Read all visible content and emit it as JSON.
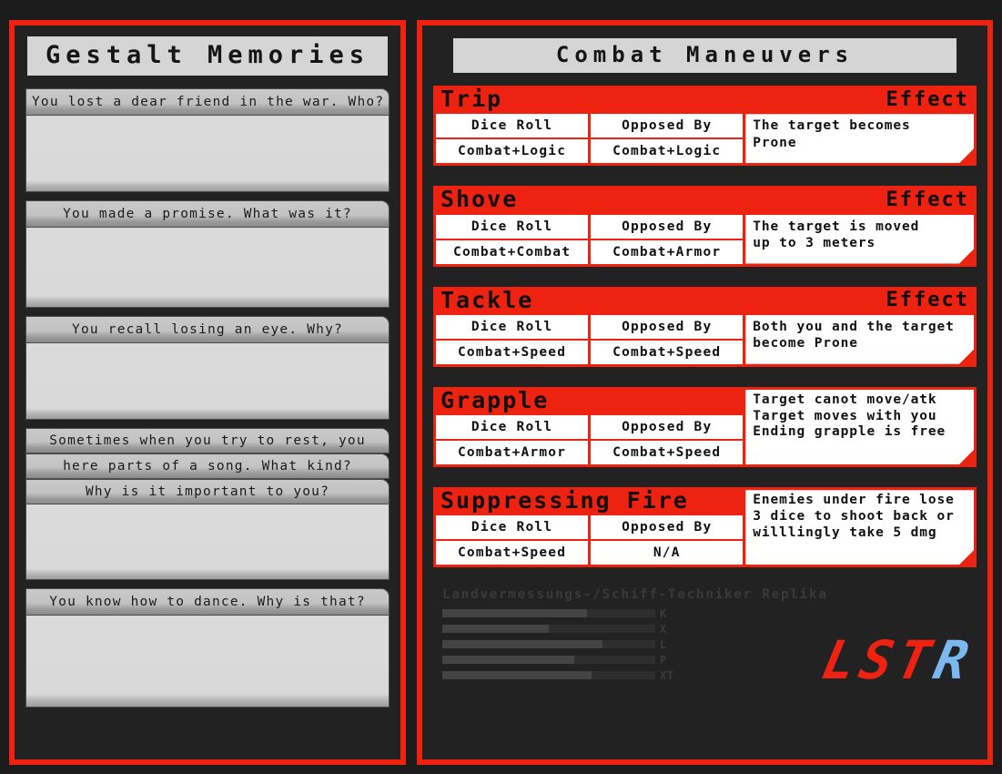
{
  "theme": {
    "accent_red": "#ee2211",
    "panel_bg": "#222222",
    "page_bg": "#1c1c1c",
    "plate": "#d5d5d5",
    "logo_blue": "#7cb8f0"
  },
  "left_panel": {
    "title": "Gestalt Memories",
    "memories": [
      {
        "question": "You lost a dear friend in the war. Who?",
        "answer": ""
      },
      {
        "question": "You made a promise. What was it?",
        "answer": ""
      },
      {
        "question": "You recall losing an eye. Why?",
        "answer": ""
      },
      {
        "question": "Sometimes when you try to rest, you",
        "answer": ""
      },
      {
        "question": "here parts of a song. What kind?",
        "answer": ""
      },
      {
        "question": "Why is it important to you?",
        "answer": ""
      },
      {
        "question": "You know how to dance. Why is that?",
        "answer": ""
      }
    ]
  },
  "right_panel": {
    "title": "Combat Maneuvers",
    "column_headers": {
      "dice_roll": "Dice Roll",
      "opposed_by": "Opposed By",
      "effect": "Effect"
    },
    "maneuvers": [
      {
        "name": "Trip",
        "dice_roll": "Combat+Logic",
        "opposed_by": "Combat+Logic",
        "effect": "The target becomes\nProne"
      },
      {
        "name": "Shove",
        "dice_roll": "Combat+Combat",
        "opposed_by": "Combat+Armor",
        "effect": "The target is moved\nup to 3 meters"
      },
      {
        "name": "Tackle",
        "dice_roll": "Combat+Speed",
        "opposed_by": "Combat+Speed",
        "effect": "Both you and the target\nbecome Prone"
      },
      {
        "name": "Grapple",
        "dice_roll": "Combat+Armor",
        "opposed_by": "Combat+Speed",
        "effect": "Target canot move/atk\nTarget moves with you\nEnding grapple is free"
      },
      {
        "name": "Suppressing Fire",
        "dice_roll": "Combat+Speed",
        "opposed_by": "N/A",
        "effect": "Enemies under fire lose\n3 dice to shoot back or\nwilllingly take 5 dmg"
      }
    ],
    "footer": {
      "caption": "Landvermessungs-/Schiff-Techniker Replika",
      "bars": [
        {
          "label": "K",
          "percent": 68
        },
        {
          "label": "X",
          "percent": 50
        },
        {
          "label": "L",
          "percent": 75
        },
        {
          "label": "P",
          "percent": 62
        },
        {
          "label": "XT",
          "percent": 70
        }
      ],
      "logo": {
        "primary": "LST",
        "secondary": "R"
      }
    }
  }
}
